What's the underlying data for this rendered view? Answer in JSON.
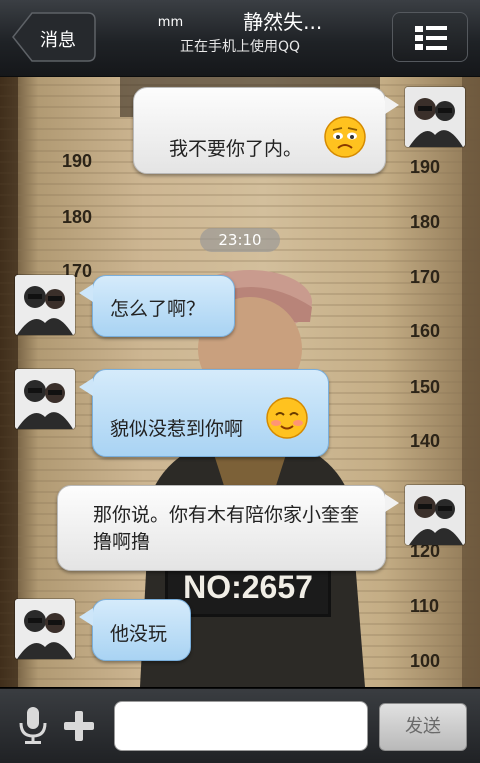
{
  "header": {
    "back_label": "消息",
    "title_prefix": "mm",
    "title": "静然失...",
    "subtitle": "正在手机上使用QQ",
    "menu_icon": "list-menu-icon"
  },
  "wall": {
    "height_marks": [
      "190",
      "180",
      "170",
      "160",
      "150",
      "140",
      "120",
      "110",
      "100"
    ],
    "sign_text": "NO:2657"
  },
  "timestamp": "23:10",
  "messages": [
    {
      "side": "right",
      "text": "我不要你了内。",
      "emoji": "sad-face-emoji"
    },
    {
      "side": "left",
      "text": "怎么了啊？"
    },
    {
      "side": "left",
      "text": "貌似没惹到你啊",
      "emoji": "smile-face-emoji"
    },
    {
      "side": "right",
      "text": "那你说。你有木有陪你家小奎奎撸啊撸"
    },
    {
      "side": "left",
      "text": "他没玩"
    }
  ],
  "input": {
    "value": "",
    "placeholder": "",
    "send_label": "发送",
    "voice_icon": "microphone-icon",
    "plus_icon": "plus-icon"
  },
  "colors": {
    "header_bg": "#1f2226",
    "bubble_right": "#f2f2f2",
    "bubble_left": "#b9dcf6",
    "wall": "#cdb692"
  }
}
